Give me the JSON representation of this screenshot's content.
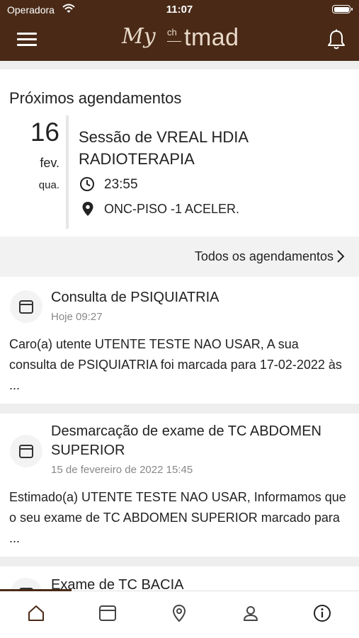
{
  "status_bar": {
    "carrier": "Operadora",
    "time": "11:07"
  },
  "header": {
    "logo_my": "My",
    "logo_ch": "ch",
    "logo_tmad": "tmad"
  },
  "upcoming": {
    "section_title": "Próximos agendamentos",
    "appointment": {
      "day": "16",
      "month": "fev.",
      "weekday": "qua.",
      "title": "Sessão de VREAL HDIA RADIOTERAPIA",
      "time": "23:55",
      "location": "ONC-PISO -1 ACELER."
    },
    "all_link_label": "Todos os agendamentos"
  },
  "notifications": [
    {
      "title": "Consulta de PSIQUIATRIA",
      "date": "Hoje 09:27",
      "body": "Caro(a) utente UTENTE TESTE NAO USAR, A sua consulta de PSIQUIATRIA foi marcada para 17-02-2022 às ..."
    },
    {
      "title": "Desmarcação de exame de TC ABDOMEN SUPERIOR",
      "date": "15 de fevereiro de 2022 15:45",
      "body": "Estimado(a) UTENTE TESTE NAO USAR, Informamos que o seu exame de TC ABDOMEN SUPERIOR marcado para ..."
    },
    {
      "title": "Exame de TC BACIA",
      "date": "",
      "body": ""
    }
  ],
  "tabbar": {
    "items": [
      "home-icon",
      "calendar-icon",
      "location-pin-icon",
      "user-icon",
      "info-icon"
    ],
    "active": "home",
    "accent_color": "#4a2a17"
  },
  "colors": {
    "brand": "#4a2a17",
    "logo": "#e8d9c8"
  }
}
